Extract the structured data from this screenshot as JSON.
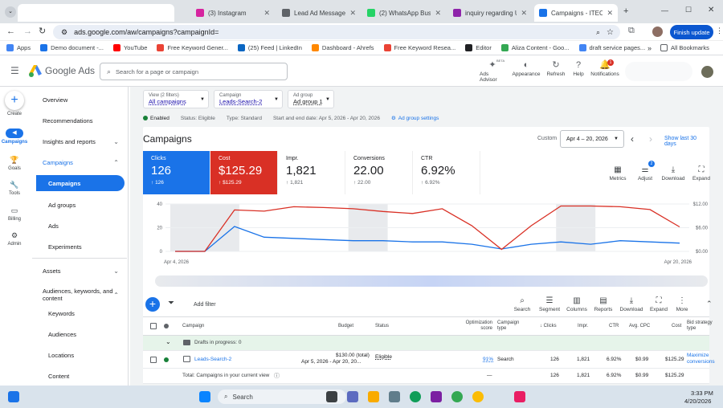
{
  "browser": {
    "tabs": [
      {
        "title": "",
        "color": "#ffffff"
      },
      {
        "title": "(3) Instagram",
        "color": "#d6249f"
      },
      {
        "title": "Lead Ad Message D",
        "color": "#5f6368"
      },
      {
        "title": "(2) WhatsApp Busin",
        "color": "#25d366"
      },
      {
        "title": "inquiry regarding UI",
        "color": "#8e24aa"
      },
      {
        "title": "Campaigns - ITEC W",
        "color": "#1a73e8"
      }
    ],
    "url": "ads.google.com/aw/campaigns?campaignId=",
    "update_label": "Finish update",
    "bookmarks": [
      {
        "label": "Apps",
        "color": "#4285f4"
      },
      {
        "label": "Demo document -...",
        "color": "#1a73e8"
      },
      {
        "label": "YouTube",
        "color": "#ff0000"
      },
      {
        "label": "Free Keyword Gener...",
        "color": "#ea4335"
      },
      {
        "label": "(25) Feed | LinkedIn",
        "color": "#0a66c2"
      },
      {
        "label": "Dashboard - Ahrefs",
        "color": "#ff8800"
      },
      {
        "label": "Free Keyword Resea...",
        "color": "#ea4335"
      },
      {
        "label": "Editor",
        "color": "#202124"
      },
      {
        "label": "Aliza Content - Goo...",
        "color": "#34a853"
      },
      {
        "label": "draft service pages...",
        "color": "#4285f4"
      }
    ],
    "all_bookmarks": "All Bookmarks"
  },
  "ads": {
    "product": "Google Ads",
    "search_placeholder": "Search for a page or campaign",
    "header_buttons": [
      {
        "label": "Ads Advisor",
        "icon": "sparkle-icon",
        "badge": "BETA"
      },
      {
        "label": "Appearance",
        "icon": "palette-icon"
      },
      {
        "label": "Refresh",
        "icon": "refresh-icon"
      },
      {
        "label": "Help",
        "icon": "help-icon"
      },
      {
        "label": "Notifications",
        "icon": "bell-icon",
        "badge": "1"
      }
    ],
    "rail": [
      {
        "label": "Create",
        "icon": "plus-icon"
      },
      {
        "label": "Campaigns",
        "icon": "megaphone-icon"
      },
      {
        "label": "Goals",
        "icon": "trophy-icon"
      },
      {
        "label": "Tools",
        "icon": "wrench-icon"
      },
      {
        "label": "Billing",
        "icon": "card-icon"
      },
      {
        "label": "Admin",
        "icon": "gear-icon"
      }
    ],
    "nav": [
      {
        "label": "Overview"
      },
      {
        "label": "Recommendations"
      },
      {
        "label": "Insights and reports"
      },
      {
        "label": "Campaigns"
      },
      {
        "label": "Campaigns"
      },
      {
        "label": "Ad groups"
      },
      {
        "label": "Ads"
      },
      {
        "label": "Experiments"
      },
      {
        "label": "Assets"
      },
      {
        "label": "Audiences, keywords, and content"
      },
      {
        "label": "Keywords"
      },
      {
        "label": "Audiences"
      },
      {
        "label": "Locations"
      },
      {
        "label": "Content"
      }
    ],
    "filters": {
      "view_label": "View (2 filters)",
      "view_value": "All campaigns",
      "campaign_label": "Campaign",
      "campaign_value": "Leads-Search-2",
      "adgroup_label": "Ad group",
      "adgroup_value": "Ad group 1"
    },
    "status_row": {
      "enabled": "Enabled",
      "status": "Status: Eligible",
      "type": "Type: Standard",
      "dates": "Start and end date: Apr 5, 2026 - Apr 20, 2026",
      "settings": "Ad group settings"
    },
    "page_title": "Campaigns",
    "date": {
      "preset": "Custom",
      "range": "Apr 4 – 20, 2026",
      "show_last": "Show last 30 days"
    },
    "kpis": [
      {
        "title": "Clicks",
        "value": "126",
        "delta": "126",
        "bg": "#1a73e8",
        "fg": "#ffffff"
      },
      {
        "title": "Cost",
        "value": "$125.29",
        "delta": "$125.29",
        "bg": "#d93025",
        "fg": "#ffffff"
      },
      {
        "title": "Impr.",
        "value": "1,821",
        "delta": "1,821",
        "bg": "#ffffff",
        "fg": "#202124"
      },
      {
        "title": "Conversions",
        "value": "22.00",
        "delta": "22.00",
        "bg": "#ffffff",
        "fg": "#202124"
      },
      {
        "title": "CTR",
        "value": "6.92%",
        "delta": "6.92%",
        "bg": "#ffffff",
        "fg": "#202124"
      }
    ],
    "chart_tools": [
      {
        "label": "Metrics",
        "icon": "metrics-icon"
      },
      {
        "label": "Adjust",
        "icon": "adjust-icon",
        "badge": "2"
      },
      {
        "label": "Download",
        "icon": "download-icon"
      },
      {
        "label": "Expand",
        "icon": "expand-icon"
      }
    ],
    "table_tools": [
      {
        "label": "Search",
        "icon": "search-icon"
      },
      {
        "label": "Segment",
        "icon": "segment-icon"
      },
      {
        "label": "Columns",
        "icon": "columns-icon"
      },
      {
        "label": "Reports",
        "icon": "reports-icon"
      },
      {
        "label": "Download",
        "icon": "download-icon"
      },
      {
        "label": "Expand",
        "icon": "expand-icon"
      },
      {
        "label": "More",
        "icon": "more-icon"
      }
    ],
    "add_filter": "Add filter",
    "columns": [
      "Campaign",
      "Budget",
      "Status",
      "Optimization score",
      "Campaign type",
      "Clicks",
      "Impr.",
      "CTR",
      "Avg. CPC",
      "Cost",
      "Bid strategy type"
    ],
    "drafts": "Drafts in progress: 0",
    "row": {
      "campaign": "Leads-Search-2",
      "budget": "$130.00 (total)",
      "budget_dates": "Apr 5, 2026 - Apr 20, 20...",
      "status": "Eligible",
      "opt": "91%",
      "type": "Search",
      "clicks": "126",
      "impr": "1,821",
      "ctr": "6.92%",
      "cpc": "$0.99",
      "cost": "$125.29",
      "bid": "Maximize conversions"
    },
    "total": {
      "label": "Total: Campaigns in your current view",
      "opt": "—",
      "clicks": "126",
      "impr": "1,821",
      "ctr": "6.92%",
      "cpc": "$0.99",
      "cost": "$125.29"
    }
  },
  "chart_data": {
    "type": "line",
    "x_start": "Apr 4, 2026",
    "x_end": "Apr 20, 2026",
    "left_ticks": [
      "40",
      "20",
      "0"
    ],
    "right_ticks": [
      "$12.00",
      "$6.00",
      "$0.00"
    ],
    "ylim_left": [
      0,
      40
    ],
    "ylim_right": [
      0,
      12
    ],
    "series": [
      {
        "name": "Clicks",
        "color": "#1a73e8",
        "axis": "left",
        "values": [
          0,
          0,
          21,
          12,
          11,
          10,
          9,
          9,
          8,
          8,
          6,
          2,
          6,
          8,
          6,
          9,
          8,
          7
        ]
      },
      {
        "name": "Cost",
        "color": "#d93025",
        "axis": "right",
        "values": [
          0,
          0,
          10.5,
          10.2,
          11.3,
          11.1,
          10.8,
          10.1,
          9.6,
          10.8,
          6.5,
          0.5,
          6.5,
          11.5,
          11.5,
          11.3,
          10.6,
          6.2
        ]
      }
    ]
  },
  "taskbar": {
    "search": "Search",
    "time": "3:33 PM",
    "date": "4/20/2026"
  }
}
